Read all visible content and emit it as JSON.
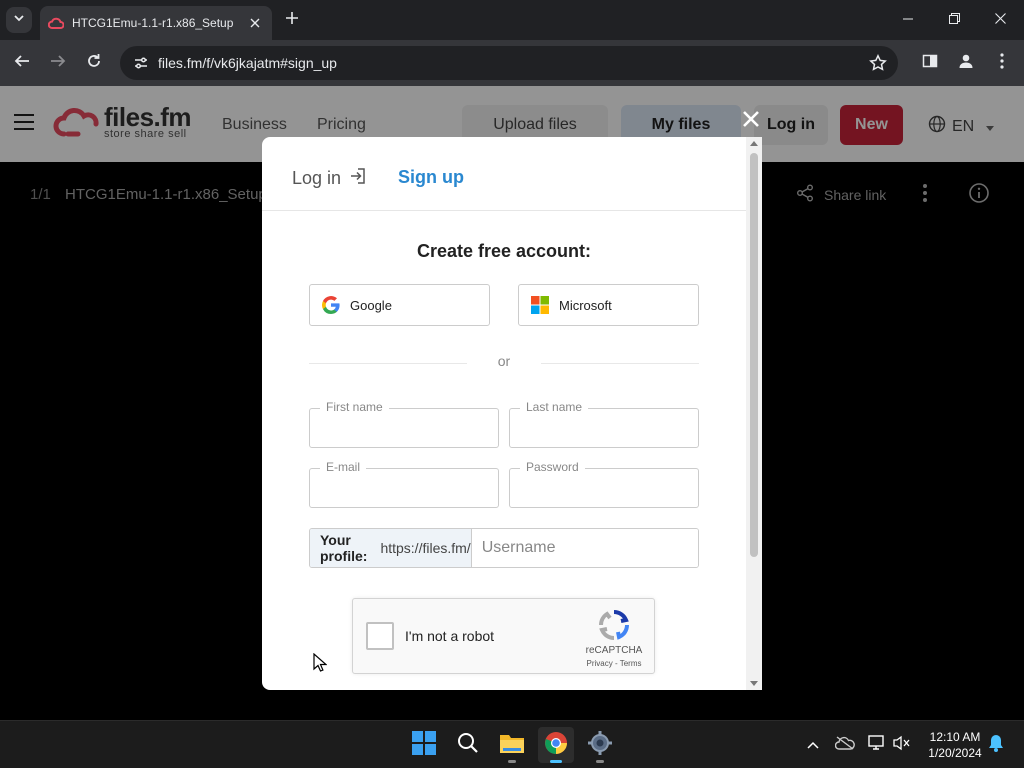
{
  "browser": {
    "tab_title": "HTCG1Emu-1.1-r1.x86_Setup",
    "url": "files.fm/f/vk6jkajatm#sign_up"
  },
  "site": {
    "logo_name": "files.fm",
    "logo_tagline": "store share sell",
    "nav": {
      "business": "Business",
      "pricing": "Pricing"
    },
    "upload_label": "Upload files",
    "myfiles_label": "My files",
    "login_label": "Log in",
    "new_label": "New",
    "language": "EN",
    "colors": {
      "new_button": "#c8233a",
      "accent_blue": "#2a88d0"
    }
  },
  "fileview": {
    "counter": "1/1",
    "file_name": "HTCG1Emu-1.1-r1.x86_Setup",
    "share_label": "Share link"
  },
  "modal": {
    "tab_login": "Log in",
    "tab_signup": "Sign up",
    "heading": "Create free account:",
    "google_label": "Google",
    "microsoft_label": "Microsoft",
    "or_text": "or",
    "fields": {
      "first_name": "First name",
      "last_name": "Last name",
      "email": "E-mail",
      "password": "Password"
    },
    "profile": {
      "label": "Your profile:",
      "domain": "https://files.fm/",
      "username_placeholder": "Username"
    },
    "recaptcha": {
      "text": "I'm not a robot",
      "brand": "reCAPTCHA",
      "terms": "Privacy - Terms"
    }
  },
  "taskbar": {
    "apps": [
      "windows-start",
      "search",
      "file-explorer",
      "chrome",
      "settings"
    ],
    "time": "12:10 AM",
    "date": "1/20/2024"
  }
}
